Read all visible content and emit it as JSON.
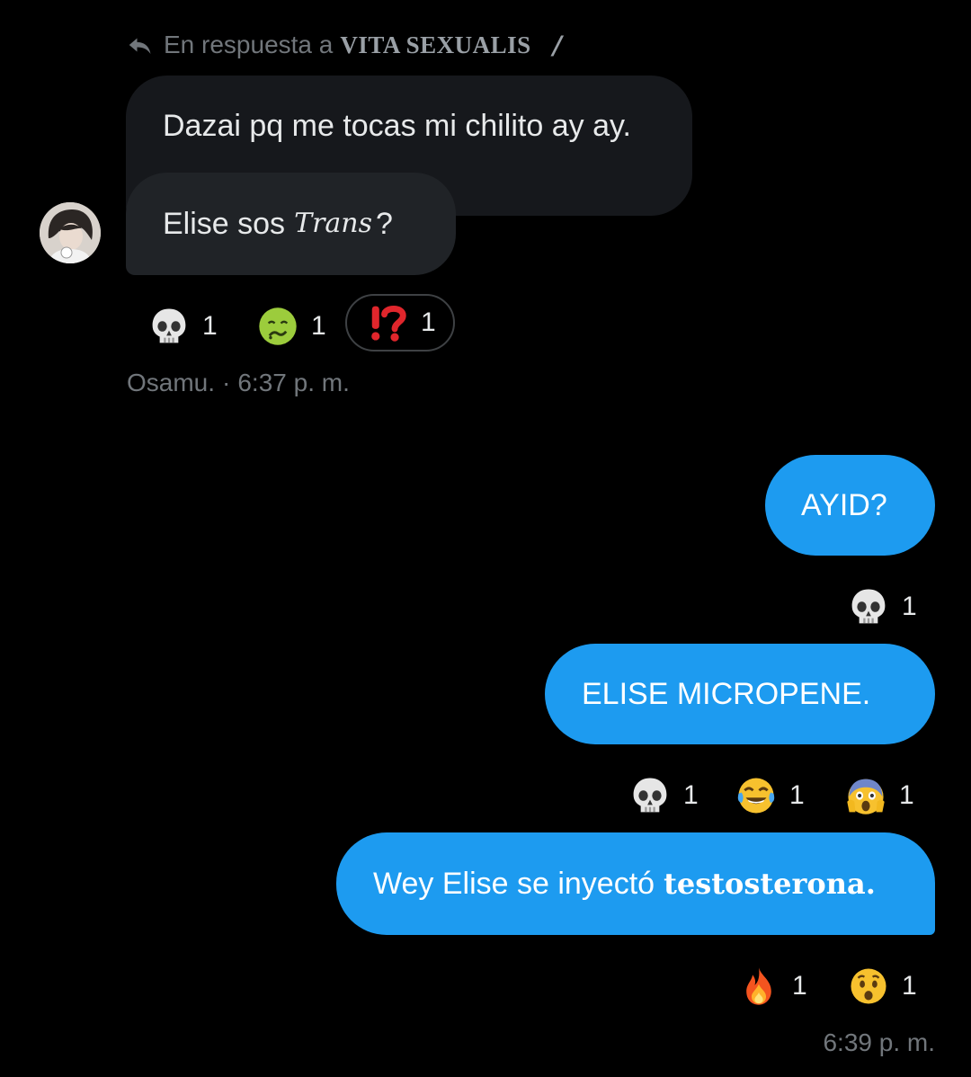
{
  "reply": {
    "prefix": "En respuesta a",
    "target": "VITA SEXUALIS",
    "mark": "/"
  },
  "incoming": {
    "messages": [
      {
        "text": "Dazai pq me tocas mi chilito ay ay."
      },
      {
        "text_before": "Elise sos",
        "styled_word": "Trans",
        "text_after": "?"
      }
    ],
    "reactions": [
      {
        "emoji": "skull",
        "count": "1",
        "selected": false
      },
      {
        "emoji": "nauseated-face",
        "count": "1",
        "selected": false
      },
      {
        "emoji": "exclamation-question-mark",
        "count": "1",
        "selected": true
      }
    ],
    "sender": "Osamu.",
    "separator": "·",
    "time": "6:37 p. m."
  },
  "outgoing": {
    "messages": [
      {
        "text": "AYID?",
        "reactions": [
          {
            "emoji": "skull",
            "count": "1"
          }
        ]
      },
      {
        "text": "ELISE MICROPENE.",
        "reactions": [
          {
            "emoji": "skull",
            "count": "1"
          },
          {
            "emoji": "tears-of-joy",
            "count": "1"
          },
          {
            "emoji": "screaming-face",
            "count": "1"
          }
        ]
      },
      {
        "text_before": "Wey Elise se inyectó",
        "styled_word": "testosterona.",
        "reactions": [
          {
            "emoji": "fire",
            "count": "1"
          },
          {
            "emoji": "hushed-face",
            "count": "1"
          }
        ]
      }
    ],
    "time": "6:39 p. m."
  },
  "colors": {
    "background": "#000000",
    "incoming_bubble": "#16181c",
    "outgoing_bubble": "#1d9bf0",
    "meta_text": "#71767b"
  }
}
